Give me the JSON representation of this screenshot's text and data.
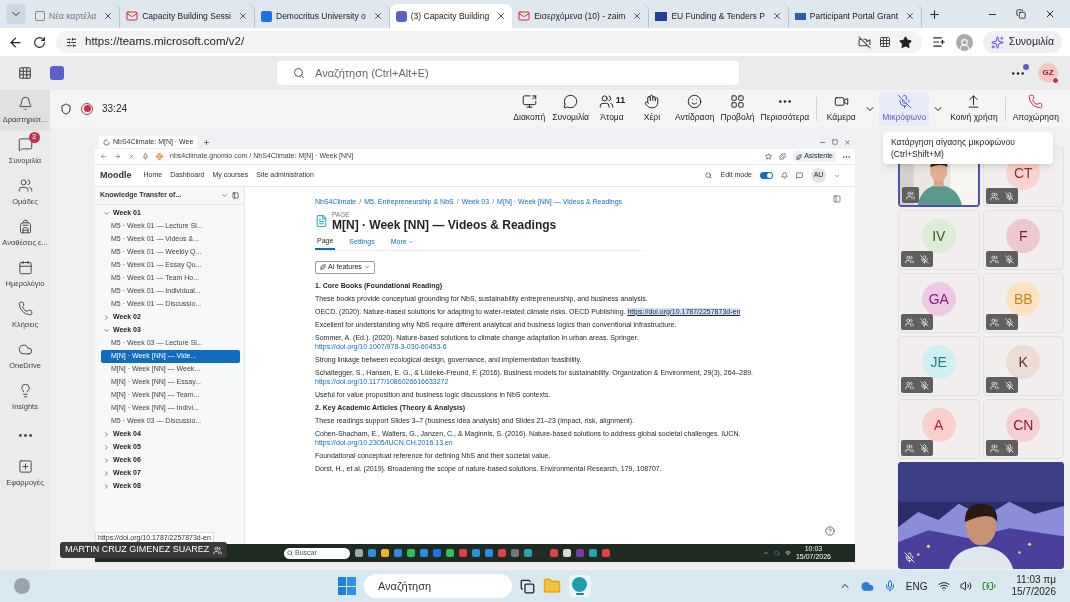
{
  "browser": {
    "tabs": [
      {
        "kind": "newtab",
        "title": "Νέα καρτέλα",
        "selected": false
      },
      {
        "kind": "gmail",
        "title": "Capacity Building Sessi",
        "selected": false
      },
      {
        "kind": "calendar",
        "title": "Democritus University o",
        "selected": false
      },
      {
        "kind": "teams",
        "title": "(3) Capacity Building",
        "selected": true
      },
      {
        "kind": "gmail",
        "title": "Εισερχόμενα (10) - zaim",
        "selected": false
      },
      {
        "kind": "eu",
        "title": "EU Funding & Tenders P",
        "selected": false
      },
      {
        "kind": "portal",
        "title": "Participant Portal Grant",
        "selected": false
      }
    ],
    "url": "https://teams.microsoft.com/v2/",
    "copilot_label": "Συνομιλία"
  },
  "teams": {
    "search_placeholder": "Αναζήτηση (Ctrl+Alt+E)",
    "avatar": "GZ"
  },
  "rail": [
    {
      "kind": "item",
      "label": "Δραστηριότ..."
    },
    {
      "kind": "item",
      "label": "Συνομιλία",
      "badge": "3"
    },
    {
      "kind": "item",
      "label": "Ομάδες"
    },
    {
      "kind": "item",
      "label": "Αναθέσεις ε..."
    },
    {
      "kind": "item",
      "label": "Ημερολόγιο"
    },
    {
      "kind": "item",
      "label": "Κλήσεις"
    },
    {
      "kind": "item",
      "label": "OneDrive"
    },
    {
      "kind": "item",
      "label": "Insights"
    },
    {
      "kind": "more"
    },
    {
      "kind": "item",
      "label": "Εφαρμογές"
    }
  ],
  "meeting": {
    "timer": "33:24",
    "recording": true,
    "actions": [
      {
        "kind": "button",
        "label": "Διακοπή",
        "highlighted": false
      },
      {
        "kind": "button",
        "label": "Συνομιλία",
        "highlighted": false
      },
      {
        "kind": "people",
        "label": "Άτομα",
        "count": "11",
        "highlighted": false
      },
      {
        "kind": "button",
        "label": "Χέρι",
        "highlighted": false
      },
      {
        "kind": "button",
        "label": "Αντίδραση",
        "highlighted": false
      },
      {
        "kind": "button",
        "label": "Προβολή",
        "highlighted": false
      },
      {
        "kind": "button",
        "label": "Περισσότερα",
        "highlighted": false
      },
      {
        "kind": "split",
        "label": "Κάμερα",
        "highlighted": false
      },
      {
        "kind": "split",
        "label": "Μικρόφωνο",
        "highlighted": true
      },
      {
        "kind": "share",
        "label": "Κοινή χρήση",
        "highlighted": false
      },
      {
        "kind": "leave",
        "label": "Αποχώρηση",
        "highlighted": false
      }
    ]
  },
  "tooltip": {
    "lines": [
      "Κατάργηση σίγασης μικροφώνου",
      "(Ctrl+Shift+M)"
    ]
  },
  "presenter_label": "MARTIN CRUZ GIMENEZ SUAREZ",
  "tiles": [
    {
      "kind": "video",
      "muted": false
    },
    {
      "kind": "avatar",
      "initials": "CT",
      "color": "#f8d3cf",
      "muted": true
    },
    {
      "kind": "avatar",
      "initials": "IV",
      "color": "#dcecd6",
      "muted": true
    },
    {
      "kind": "avatar",
      "initials": "F",
      "color": "#ecc9cf",
      "muted": true
    },
    {
      "kind": "avatar",
      "initials": "GA",
      "color": "#eccae6",
      "muted": true
    },
    {
      "kind": "avatar",
      "initials": "BB",
      "color": "#fde2c2",
      "muted": true
    },
    {
      "kind": "avatar",
      "initials": "JE",
      "color": "#cfeff3",
      "muted": true
    },
    {
      "kind": "avatar",
      "initials": "K",
      "color": "#ecdcd6",
      "muted": true
    },
    {
      "kind": "avatar",
      "initials": "A",
      "color": "#f9d0cc",
      "muted": true
    },
    {
      "kind": "avatar",
      "initials": "CN",
      "color": "#f3d0d3",
      "muted": true
    }
  ],
  "self_view": {
    "kind": "picture",
    "muted": true
  },
  "shared_screen": {
    "tab_title": "NbS4Climate: M[N] · Wee",
    "url": "nbs4climate.gnomio.com / NbS4Climate: M[N] · Week [NN]",
    "assistant": "Asistente",
    "brand": "Moodle",
    "nav": [
      "Home",
      "Dashboard",
      "My courses",
      "Site administration"
    ],
    "edit_mode_label": "Edit mode",
    "edit_mode": true,
    "user": "AU",
    "course_index_title": "Knowledge Transfer of...",
    "course_index": [
      {
        "label": "Week 01",
        "expanded": true,
        "children": [
          {
            "label": "M5 · Week 01 — Lecture Sl...",
            "selected": false
          },
          {
            "label": "M5 · Week 01 — Videos &...",
            "selected": false
          },
          {
            "label": "M5 · Week 01 — Weekly Q...",
            "selected": false
          },
          {
            "label": "M5 · Week 01 — Essay Qu...",
            "selected": false
          },
          {
            "label": "M5 · Week 01 — Team Ho...",
            "selected": false
          },
          {
            "label": "M5 · Week 01 — Individual...",
            "selected": false
          },
          {
            "label": "M5 · Week 01 — Discussio...",
            "selected": false
          }
        ]
      },
      {
        "label": "Week 02",
        "expanded": false
      },
      {
        "label": "Week 03",
        "expanded": true,
        "children": [
          {
            "label": "M5 · Week 03 — Lecture Sl...",
            "selected": false
          },
          {
            "label": "M[N] · Week [NN] — Vide...",
            "selected": true
          },
          {
            "label": "M[N] · Week [NN] — Week...",
            "selected": false
          },
          {
            "label": "M[N] · Week [NN] — Essay...",
            "selected": false
          },
          {
            "label": "M[N] · Week [NN] — Team...",
            "selected": false
          },
          {
            "label": "M[N] · Week [NN] — Indivi...",
            "selected": false
          },
          {
            "label": "M5 · Week 03 — Discussio...",
            "selected": false
          }
        ]
      },
      {
        "label": "Week 04",
        "expanded": false
      },
      {
        "label": "Week 05",
        "expanded": false
      },
      {
        "label": "Week 06",
        "expanded": false
      },
      {
        "label": "Week 07",
        "expanded": false
      },
      {
        "label": "Week 08",
        "expanded": false
      }
    ],
    "status_url": "https://doi.org/10.1787/2257873d-en",
    "breadcrumb_separator": "/",
    "breadcrumb": [
      "NbS4Climate",
      "M5. Entrepreneurship & NbS",
      "Week 03",
      "M[N] · Week [NN] — Videos & Readings"
    ],
    "page_kind": "PAGE",
    "title": "M[N] · Week [NN] — Videos & Readings",
    "tabs": [
      {
        "label": "Page",
        "selected": true
      },
      {
        "label": "Settings",
        "selected": false
      },
      {
        "label": "More",
        "selected": false
      }
    ],
    "ai_button": "AI features",
    "content": [
      {
        "kind": "heading",
        "text": "1. Core Books (Foundational Reading)"
      },
      {
        "kind": "para",
        "text": "These books provide conceptual grounding for NbS, sustainability entrepreneurship, and business analysis."
      },
      {
        "kind": "ref",
        "text": "OECD. (2020). Nature-based solutions for adapting to water-related climate risks. OECD Publishing.",
        "link": "https://doi.org/10.1787/2257873d-en",
        "highlighted": true
      },
      {
        "kind": "para",
        "text": "Excellent for understanding why NbS require different analytical and business logics than conventional infrastructure."
      },
      {
        "kind": "ref",
        "text": "Sommer, A. (Ed.). (2020). Nature-based solutions to climate change adaptation in urban areas. Springer.",
        "link": "https://doi.org/10.1007/978-3-030-60453-6",
        "highlighted": false
      },
      {
        "kind": "para",
        "text": "Strong linkage between ecological design, governance, and implementation feasibility."
      },
      {
        "kind": "ref",
        "text": "Schaltegger, S., Hansen, E. G., & Lüdeke-Freund, F. (2016). Business models for sustainability. Organization & Environment, 29(3), 264–289.",
        "link": "https://doi.org/10.1177/1086026616633272",
        "highlighted": false
      },
      {
        "kind": "para",
        "text": "Useful for value proposition and business logic discussions in NbS contexts."
      },
      {
        "kind": "heading",
        "text": "2. Key Academic Articles (Theory & Analysis)"
      },
      {
        "kind": "para",
        "text": "These readings support Slides 3–7 (business idea analysis) and Slides 21–23 (impact, risk, alignment)."
      },
      {
        "kind": "ref",
        "text": "Cohen-Shacham, E., Walters, G., Janzen, C., & Maginnis, S. (2016). Nature-based solutions to address global societal challenges. IUCN.",
        "link": "https://doi.org/10.2305/IUCN.CH.2016.13.en",
        "highlighted": false
      },
      {
        "kind": "para",
        "text": "Foundational conceptual reference for defining NbS and their societal value."
      },
      {
        "kind": "para",
        "text": "Dorst, H., et al. (2019). Broadening the scope of nature-based solutions. Environmental Research, 179, 108707."
      }
    ],
    "taskbar": {
      "search_placeholder": "Buscar",
      "time": "10:03",
      "date": "15/07/2026"
    }
  },
  "taskbar": {
    "search_placeholder": "Αναζήτηση",
    "language": "ENG",
    "time": "11:03 πμ",
    "date": "15/7/2026"
  }
}
